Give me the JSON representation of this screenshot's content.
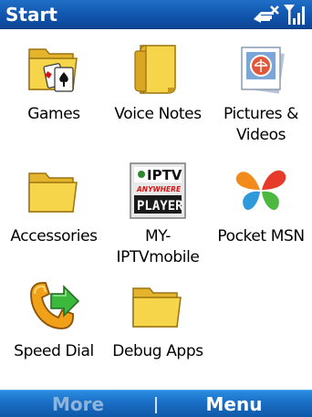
{
  "window": {
    "title": "Start"
  },
  "status": {
    "connectivity_icon": "data-connection-x-icon",
    "signal_icon": "signal-strength-icon"
  },
  "apps": [
    {
      "label": "Games",
      "icon": "games-folder-icon"
    },
    {
      "label": "Voice Notes",
      "icon": "voice-notes-icon"
    },
    {
      "label": "Pictures &\nVideos",
      "icon": "pictures-videos-icon"
    },
    {
      "label": "Accessories",
      "icon": "folder-icon"
    },
    {
      "label": "MY-\nIPTVmobile",
      "icon": "iptv-player-icon",
      "logo_text": [
        "IPTV",
        "ANYWHERE",
        "PLAYER"
      ]
    },
    {
      "label": "Pocket MSN",
      "icon": "msn-butterfly-icon"
    },
    {
      "label": "Speed Dial",
      "icon": "speed-dial-icon"
    },
    {
      "label": "Debug Apps",
      "icon": "folder-icon"
    }
  ],
  "softkeys": {
    "left_label": "More",
    "right_label": "Menu"
  },
  "colors": {
    "titlebar": "#1257b0",
    "softbar": "#1a6fc6",
    "folder": "#f7d54a",
    "disabled_softkey": "#8cb4dc"
  }
}
